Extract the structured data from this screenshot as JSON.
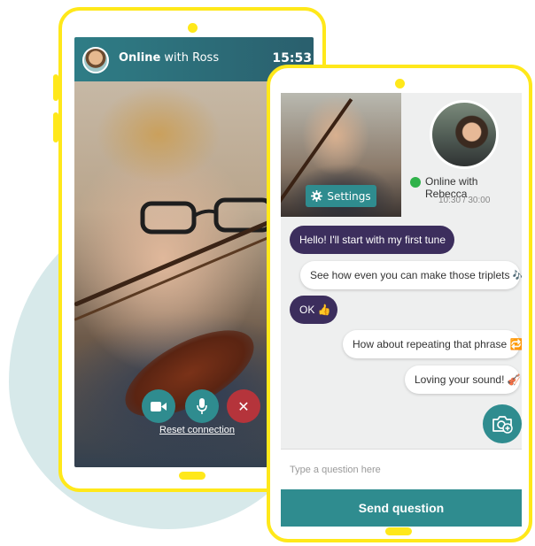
{
  "colors": {
    "accent": "#2f8c8f",
    "device_frame": "#ffe81a",
    "bubble_dark": "#3c2e5d",
    "online": "#2fb24a",
    "hangup": "#b5343b"
  },
  "phone_left": {
    "header": {
      "name_bold": "Online",
      "name_rest": " with Ross",
      "time": "15:53"
    },
    "controls": {
      "video_icon": "video-camera-icon",
      "mic_icon": "microphone-icon",
      "end_icon": "close-icon",
      "end_glyph": "✕"
    },
    "reset_link": "Reset connection"
  },
  "phone_right": {
    "settings_label": "Settings",
    "status": {
      "label": "Online with Rebecca",
      "timer": "10:30 / 30:00"
    },
    "messages": [
      {
        "text": "Hello! I'll start with my first tune",
        "side": "left"
      },
      {
        "text": "See how even you can make those triplets 🎶",
        "side": "right"
      },
      {
        "text": "OK 👍",
        "side": "left"
      },
      {
        "text": "How about repeating that phrase 🔁",
        "side": "right"
      },
      {
        "text": "Loving your sound! 🎻",
        "side": "right"
      }
    ],
    "attach_icon": "camera-add-icon",
    "input_placeholder": "Type a question here",
    "send_label": "Send question"
  }
}
